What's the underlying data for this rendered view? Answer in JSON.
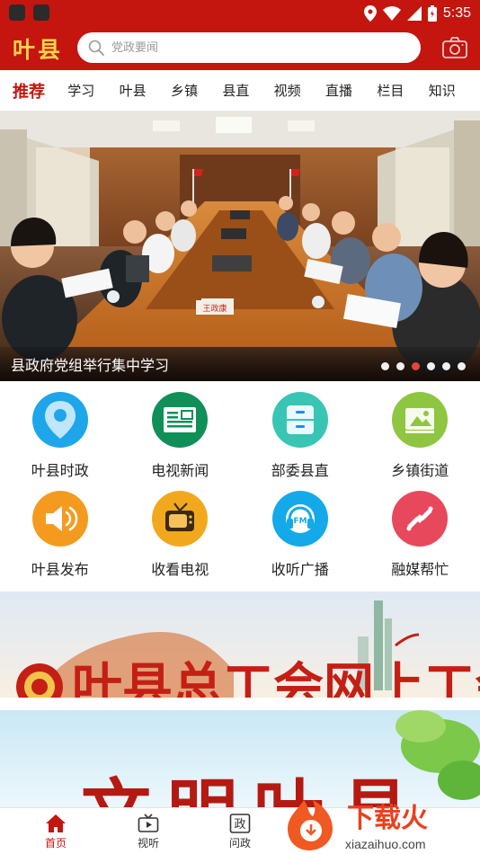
{
  "status_bar": {
    "time": "5:35"
  },
  "header": {
    "logo": "叶县",
    "search_placeholder": "党政要闻"
  },
  "tabs": [
    {
      "label": "推荐",
      "active": true
    },
    {
      "label": "学习"
    },
    {
      "label": "叶县"
    },
    {
      "label": "乡镇"
    },
    {
      "label": "县直"
    },
    {
      "label": "视频"
    },
    {
      "label": "直播"
    },
    {
      "label": "栏目"
    },
    {
      "label": "知识"
    }
  ],
  "banner": {
    "caption": "县政府党组举行集中学习",
    "active_dot": 3,
    "dot_count": 6,
    "nameplate": "王政康"
  },
  "grid": [
    {
      "label": "叶县时政",
      "icon": "location-pin-icon",
      "color": "#1aa3e8"
    },
    {
      "label": "电视新闻",
      "icon": "newspaper-icon",
      "color": "#0f8f5a"
    },
    {
      "label": "部委县直",
      "icon": "cabinet-icon",
      "color": "#31c2b0"
    },
    {
      "label": "乡镇街道",
      "icon": "landscape-picture-icon",
      "color": "#8dc63f"
    },
    {
      "label": "叶县发布",
      "icon": "speaker-icon",
      "color": "#f39a1e"
    },
    {
      "label": "收看电视",
      "icon": "tv-icon",
      "color": "#f2a81d"
    },
    {
      "label": "收听广播",
      "icon": "radio-fm-icon",
      "color": "#12a7e6"
    },
    {
      "label": "融媒帮忙",
      "icon": "helping-hands-icon",
      "color": "#e8485b"
    }
  ],
  "promos": {
    "promo1_text": "叶县总工会网上工会",
    "promo2_text": "文明叶县"
  },
  "bottom_nav": [
    {
      "label": "首页",
      "icon": "home-icon",
      "active": true
    },
    {
      "label": "视听",
      "icon": "tv-play-icon"
    },
    {
      "label": "问政",
      "icon": "zheng-icon",
      "glyph": "政"
    }
  ],
  "watermark": {
    "brand": "下载火",
    "url": "xiazaihuo.com"
  }
}
